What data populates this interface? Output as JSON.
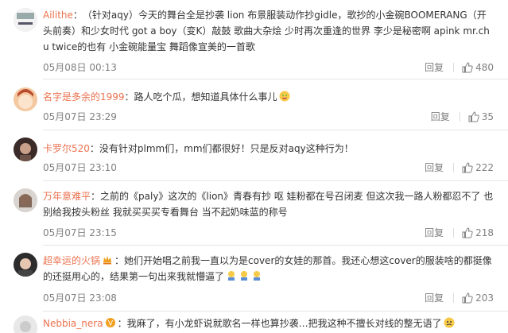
{
  "comments": [
    {
      "user": "Ailithe",
      "text": "：　（针对aqy）今天的舞台全是抄袭 lion 布景服装动作抄gidle，歌抄的小金碗BOOMERANG（开头前奏）和少女时代 got a boy（变K）敲鼓 歌曲大杂烩 少时再次重逢的世界 李少是秘密啊 apink mr.chu twice的也有 小金碗能量宝 舞蹈像宣美的一首歌",
      "time": "05月08日 00:13",
      "reply": "回复",
      "likes": "480"
    },
    {
      "user": "名字是多余的1999",
      "text": "：路人吃个瓜，想知道具体什么事儿",
      "time": "05月07日 23:29",
      "reply": "回复",
      "likes": "35"
    },
    {
      "user": "卡罗尔520",
      "text": "：没有针对plmm们，mm们都很好！只是反对aqy这种行为！",
      "time": "05月07日 23:10",
      "reply": "回复",
      "likes": "222"
    },
    {
      "user": "万年意难平",
      "text": "：之前的《paly》这次的《lion》青春有抄 呕 娃粉都在号召闭麦 但这次我一路人粉都忍不了 也别给我按头粉丝 我就买买买专看舞台 当不起奶味蓝的称号",
      "time": "05月07日 23:15",
      "reply": "回复",
      "likes": "218"
    },
    {
      "user": "超幸运的火锅",
      "text": "：她们开始唱之前我一直以为是cover的女娃的那首。我还心想这cover的服装啥的都挺像的还挺用心的，结果第一句出来我就懵逼了",
      "time": "05月07日 23:08",
      "reply": "回复",
      "likes": "203"
    },
    {
      "user": "Nebbia_nera",
      "text": "：我麻了，有小龙虾说就歌名一样也算抄袭…把我这种不擅长对线的整无语了",
      "time": "",
      "reply": "",
      "likes": ""
    }
  ],
  "colors": {
    "username": "#eb7350",
    "meta": "#808080",
    "divider": "#e6e6e6"
  },
  "icons": {
    "like": "thumbs-up-icon",
    "emoji": "emoji-icon",
    "badge": "vip-badge-icon"
  }
}
